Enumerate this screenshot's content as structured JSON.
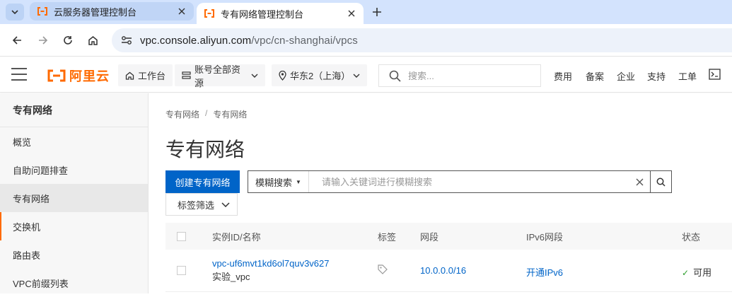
{
  "browser": {
    "tabs": [
      {
        "title": "云服务器管理控制台",
        "active": false
      },
      {
        "title": "专有网络管理控制台",
        "active": true
      }
    ],
    "url_host": "vpc.console.aliyun.com",
    "url_path": "/vpc/cn-shanghai/vpcs"
  },
  "header": {
    "logo_text": "阿里云",
    "workbench": "工作台",
    "resources": "账号全部资源",
    "region": "华东2（上海）",
    "search_placeholder": "搜索...",
    "links": [
      "费用",
      "备案",
      "企业",
      "支持",
      "工单"
    ]
  },
  "sidebar": {
    "title": "专有网络",
    "items": [
      {
        "label": "概览",
        "selected": false
      },
      {
        "label": "自助问题排查",
        "selected": false
      },
      {
        "label": "专有网络",
        "selected": true
      },
      {
        "label": "交换机",
        "selected": false
      },
      {
        "label": "路由表",
        "selected": false
      },
      {
        "label": "VPC前缀列表",
        "selected": false
      }
    ]
  },
  "main": {
    "breadcrumb": [
      "专有网络",
      "专有网络"
    ],
    "title": "专有网络",
    "create_button": "创建专有网络",
    "filter_type": "模糊搜索",
    "search_placeholder": "请输入关键词进行模糊搜索",
    "tag_filter": "标签筛选",
    "table": {
      "columns": [
        "实例ID/名称",
        "标签",
        "网段",
        "IPv6网段",
        "状态"
      ],
      "rows": [
        {
          "id": "vpc-uf6mvt1kd6ol7quv3v627",
          "name": "实验_vpc",
          "cidr": "10.0.0.0/16",
          "ipv6": "开通IPv6",
          "status": "可用"
        }
      ]
    }
  },
  "colors": {
    "accent": "#ff6a00",
    "primary": "#0064c8",
    "tab_bar": "#d3e3fd",
    "success": "#2b9e2b"
  }
}
